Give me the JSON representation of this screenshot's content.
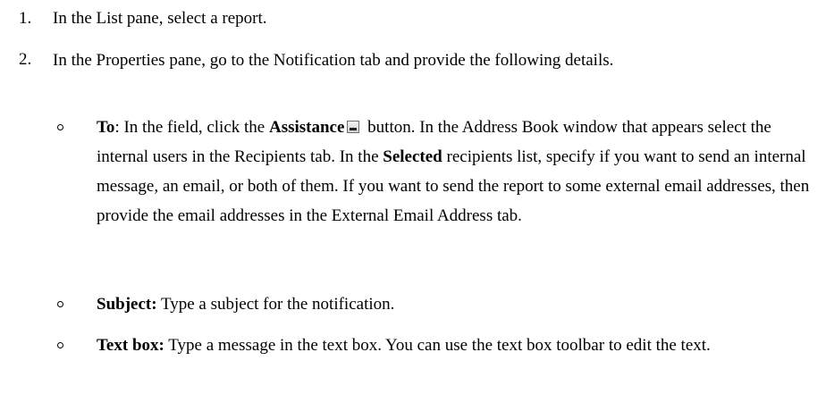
{
  "steps": [
    {
      "number": "1.",
      "text": "In the List pane, select a report."
    },
    {
      "number": "2.",
      "text": "In the Properties pane, go to the Notification tab and provide the following details."
    }
  ],
  "bullets": {
    "to": {
      "label": "To",
      "text_a": ": In the field, click the ",
      "assistance": "Assistance",
      "icon": "assistance-button-icon",
      "text_b": " button. In the Address Book window that appears select the internal users in the Recipients tab. In the ",
      "selected": "Selected",
      "text_c": " recipients list, specify if you want to send an internal message, an email, or both of them. If you want to send the report to some external email addresses, then provide the email addresses in the External Email Address tab."
    },
    "subject": {
      "label": "Subject:",
      "text": " Type a subject for the notification."
    },
    "textbox": {
      "label": "Text box:",
      "text": " Type a message in the text box. You can use the text box toolbar to edit the text."
    }
  }
}
